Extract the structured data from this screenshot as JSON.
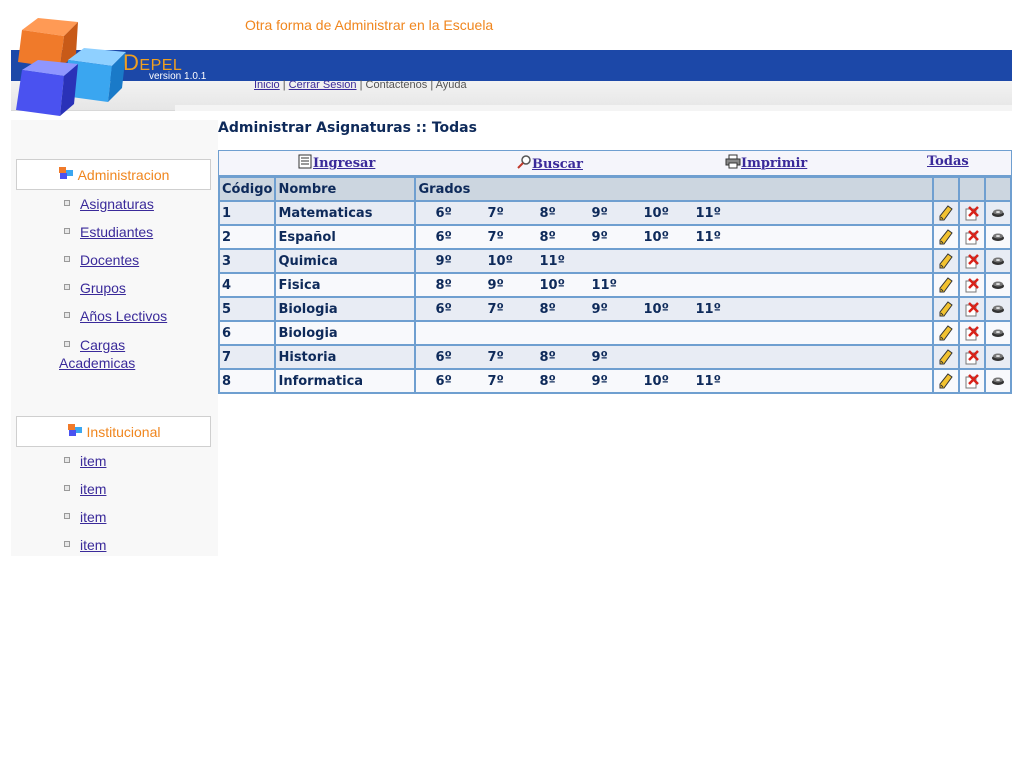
{
  "header": {
    "tagline": "Otra forma de Administrar en la Escuela",
    "brand_first": "D",
    "brand_rest": "EPEL",
    "version": "version 1.0.1",
    "nav": [
      {
        "label": "Inicio"
      },
      {
        "label": "Cerrar Sesion"
      },
      {
        "label": "Contactenos"
      },
      {
        "label": "Ayuda"
      }
    ]
  },
  "sidebar": {
    "sections": [
      {
        "title": "Administracion",
        "items": [
          "Asignaturas",
          "Estudiantes",
          "Docentes",
          "Grupos",
          "Años Lectivos",
          "Cargas",
          "Academicas"
        ]
      },
      {
        "title": "Institucional",
        "items": [
          "item",
          "item",
          "item",
          "item"
        ]
      }
    ]
  },
  "main": {
    "title": "Administrar Asignaturas :: Todas",
    "toolbar": {
      "ingresar": "Ingresar",
      "buscar": "Buscar",
      "imprimir": "Imprimir",
      "todas": "Todas"
    },
    "table": {
      "headers": {
        "code": "Código",
        "name": "Nombre",
        "grades": "Grados"
      },
      "rows": [
        {
          "code": "1",
          "name": "Matematicas",
          "grades": [
            "6º",
            "7º",
            "8º",
            "9º",
            "10º",
            "11º"
          ]
        },
        {
          "code": "2",
          "name": "Español",
          "grades": [
            "6º",
            "7º",
            "8º",
            "9º",
            "10º",
            "11º"
          ]
        },
        {
          "code": "3",
          "name": "Quimica",
          "grades": [
            "9º",
            "10º",
            "11º"
          ]
        },
        {
          "code": "4",
          "name": "Fisica",
          "grades": [
            "8º",
            "9º",
            "10º",
            "11º"
          ]
        },
        {
          "code": "5",
          "name": "Biologia",
          "grades": [
            "6º",
            "7º",
            "8º",
            "9º",
            "10º",
            "11º"
          ]
        },
        {
          "code": "6",
          "name": "Biologia",
          "grades": []
        },
        {
          "code": "7",
          "name": "Historia",
          "grades": [
            "6º",
            "7º",
            "8º",
            "9º"
          ]
        },
        {
          "code": "8",
          "name": "Informatica",
          "grades": [
            "6º",
            "7º",
            "8º",
            "9º",
            "10º",
            "11º"
          ]
        }
      ]
    }
  },
  "colors": {
    "accent_orange": "#f0861e",
    "header_blue": "#1c48a8",
    "link_purple": "#3a2a9a",
    "table_border": "#6f9fd0"
  }
}
